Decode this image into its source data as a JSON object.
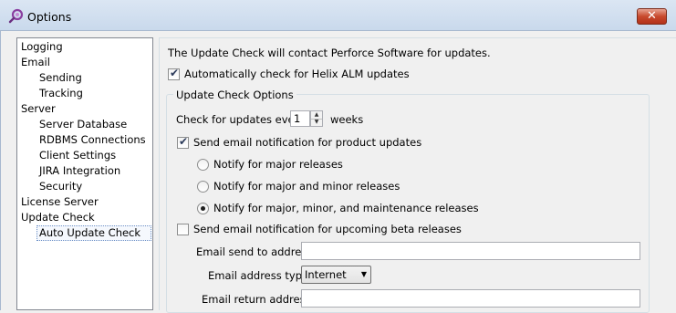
{
  "window": {
    "title": "Options",
    "close_glyph": "✕"
  },
  "tree": {
    "items": [
      {
        "label": "Logging"
      },
      {
        "label": "Email"
      },
      {
        "label": "Sending"
      },
      {
        "label": "Tracking"
      },
      {
        "label": "Server"
      },
      {
        "label": "Server Database"
      },
      {
        "label": "RDBMS Connections"
      },
      {
        "label": "Client Settings"
      },
      {
        "label": "JIRA Integration"
      },
      {
        "label": "Security"
      },
      {
        "label": "License Server"
      },
      {
        "label": "Update Check"
      },
      {
        "label": "Auto Update Check",
        "selected": true
      }
    ]
  },
  "panel": {
    "intro": "The Update Check will contact Perforce Software for updates.",
    "auto_check": {
      "label": "Automatically check for Helix ALM updates",
      "checked": true
    },
    "group_title": "Update Check Options",
    "frequency": {
      "prefix": "Check for updates every",
      "value": "1",
      "suffix": "weeks"
    },
    "product_updates": {
      "label": "Send email notification for product updates",
      "checked": true
    },
    "radios": [
      {
        "label": "Notify for major releases",
        "selected": false
      },
      {
        "label": "Notify for major and minor releases",
        "selected": false
      },
      {
        "label": "Notify for major, minor, and maintenance releases",
        "selected": true
      }
    ],
    "beta_updates": {
      "label": "Send email notification for upcoming beta releases",
      "checked": false
    },
    "email_send": {
      "label": "Email send to address:",
      "value": ""
    },
    "email_type": {
      "label": "Email address type:",
      "value": "Internet"
    },
    "email_return": {
      "label": "Email return address:",
      "value": ""
    }
  }
}
